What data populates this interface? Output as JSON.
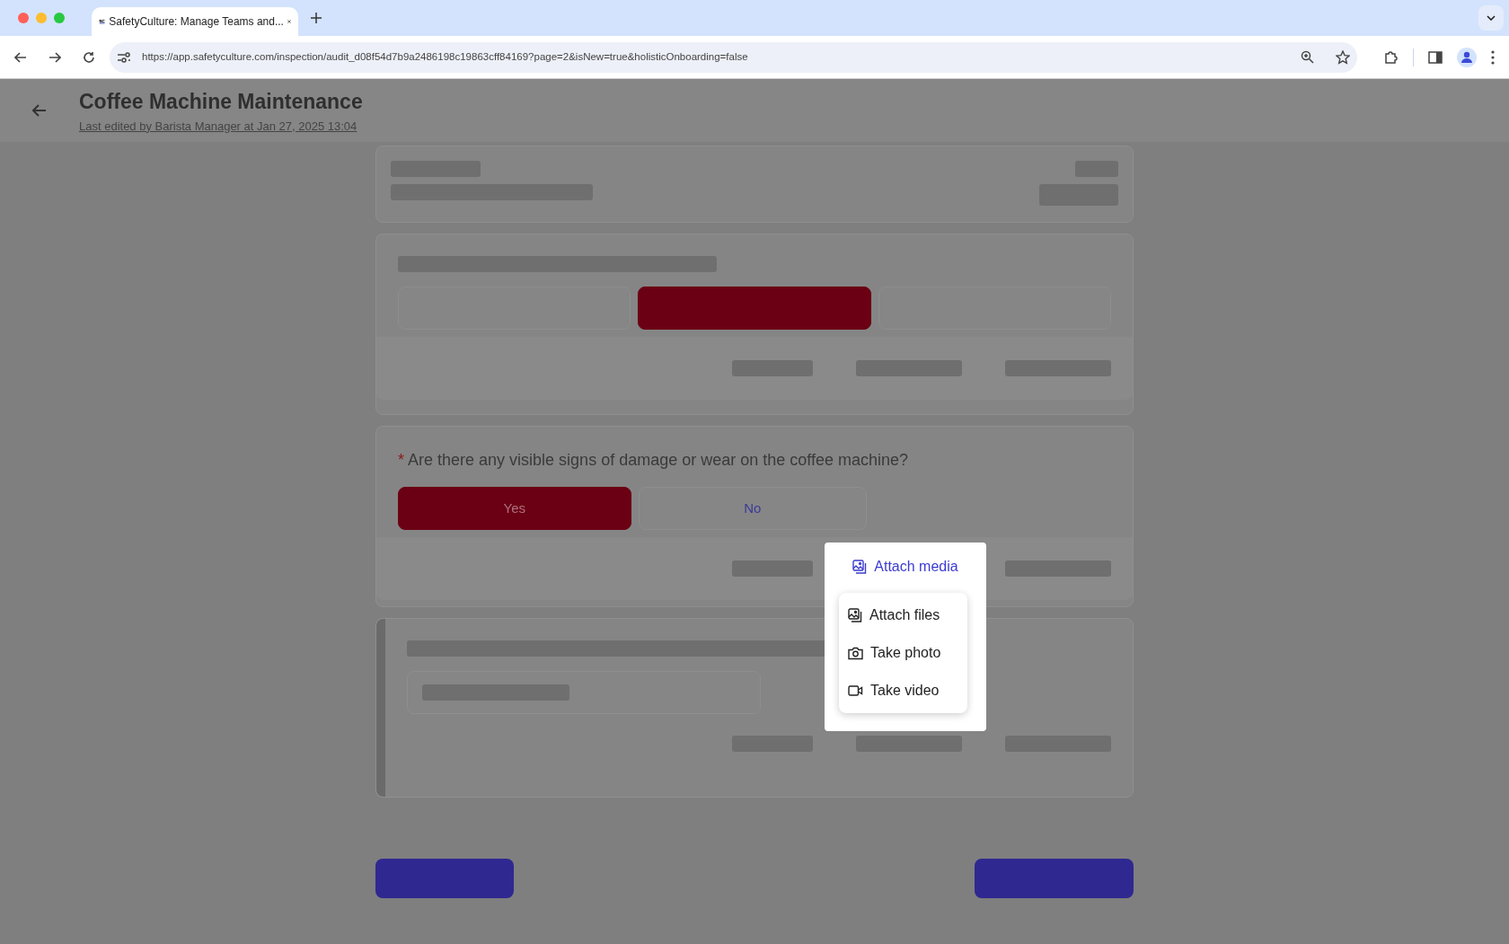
{
  "browser": {
    "tab": {
      "title": "SafetyCulture: Manage Teams and...",
      "selected": true
    },
    "url": "https://app.safetyculture.com/inspection/audit_d08f54d7b9a2486198c19863cff84169?page=2&isNew=true&holisticOnboarding=false"
  },
  "header": {
    "title": "Coffee Machine Maintenance",
    "subtitle": "Last edited by Barista Manager at Jan 27, 2025 13:04"
  },
  "loading_question": {
    "options": [
      {
        "selected": false
      },
      {
        "selected": true
      },
      {
        "selected": false
      }
    ]
  },
  "question": {
    "required_mark": "*",
    "text": "Are there any visible signs of damage or wear on the coffee machine?",
    "options": [
      {
        "label": "Yes",
        "selected": true
      },
      {
        "label": "No",
        "selected": false
      }
    ]
  },
  "popup": {
    "title": "Attach media",
    "items": [
      {
        "kind": "files",
        "label": "Attach files"
      },
      {
        "kind": "photo",
        "label": "Take photo"
      },
      {
        "kind": "video",
        "label": "Take video"
      }
    ]
  }
}
